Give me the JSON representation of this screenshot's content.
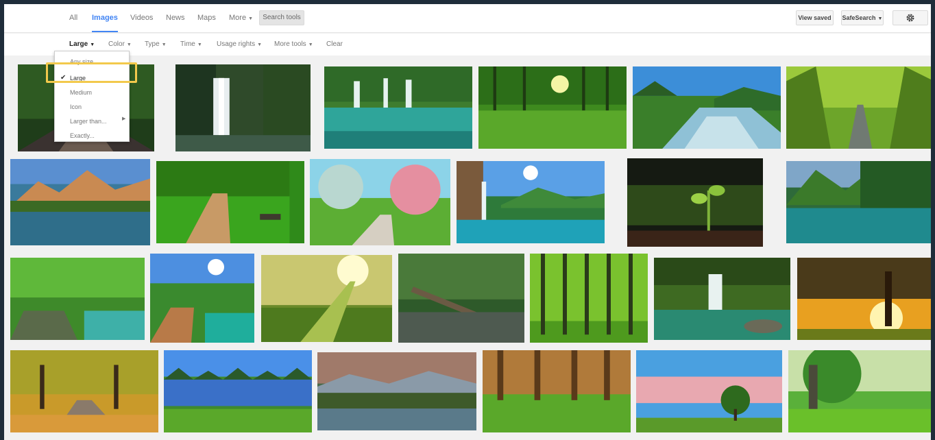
{
  "tabs": [
    {
      "label": "All",
      "active": false
    },
    {
      "label": "Images",
      "active": true
    },
    {
      "label": "Videos",
      "active": false
    },
    {
      "label": "News",
      "active": false
    },
    {
      "label": "Maps",
      "active": false
    },
    {
      "label": "More",
      "active": false
    }
  ],
  "search_tools_label": "Search tools",
  "view_saved_label": "View saved",
  "safesearch_label": "SafeSearch",
  "tools": [
    "Large",
    "Color",
    "Type",
    "Time",
    "Usage rights",
    "More tools"
  ],
  "clear_label": "Clear",
  "size_menu": {
    "items": [
      "Any size",
      "Large",
      "Medium",
      "Icon",
      "Larger than...",
      "Exactly..."
    ],
    "selected": "Large"
  },
  "colors": {
    "accent": "#4285f4",
    "highlight": "#f2c94c"
  },
  "image_results": [
    "railway-tracks-in-forest",
    "jungle-waterfall",
    "waterfalls-over-turquoise-pool",
    "sunlit-green-forest-meadow",
    "mountain-river-with-blue-sky",
    "tree-tunnel-road",
    "mountain-lake-at-sunset",
    "park-path-with-bench",
    "flowering-trees-path",
    "waterfall-and-lake-with-sunshine",
    "green-sprout-in-soil",
    "alpine-lake-with-pine-forest",
    "forest-path-by-river",
    "boardwalk-over-stream",
    "sunbeams-through-forest",
    "fallen-log-over-creek",
    "tall-bamboo-forest",
    "waterfall-in-mossy-forest",
    "tree-silhouette-at-golden-sunset",
    "autumn-park-path",
    "lake-with-mountains-reflection",
    "mountain-valley-sunrise",
    "pine-forest-with-grass",
    "lone-tree-on-hill-at-sunset",
    "big-oak-tree-on-meadow"
  ]
}
